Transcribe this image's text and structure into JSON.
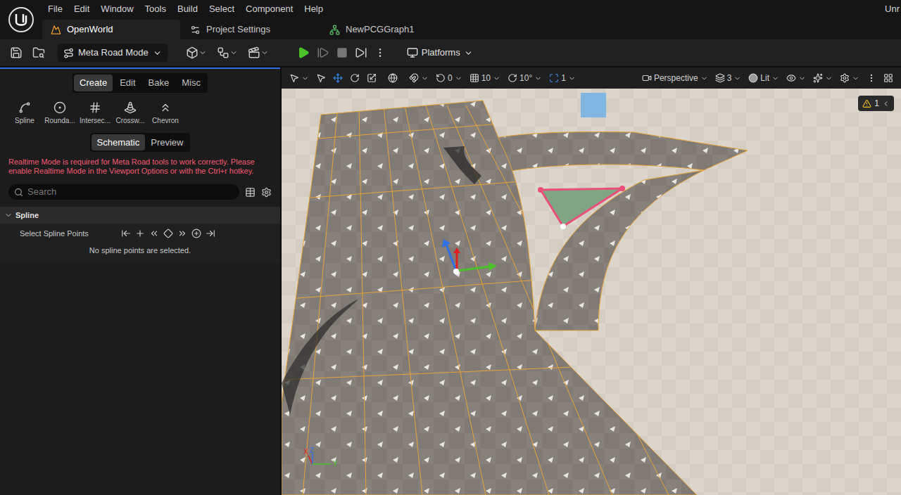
{
  "window": {
    "title": "Unr"
  },
  "menu": [
    "File",
    "Edit",
    "Window",
    "Tools",
    "Build",
    "Select",
    "Component",
    "Help"
  ],
  "document_tabs": [
    {
      "label": "OpenWorld",
      "selected": true
    },
    {
      "label": "Project Settings",
      "selected": false
    },
    {
      "label": "NewPCGGraph1",
      "selected": false
    }
  ],
  "toolbar": {
    "mode": "Meta Road Mode",
    "platforms": "Platforms"
  },
  "mode_tabs": [
    {
      "label": "Create",
      "selected": true
    },
    {
      "label": "Edit",
      "selected": false
    },
    {
      "label": "Bake",
      "selected": false
    },
    {
      "label": "Misc",
      "selected": false
    }
  ],
  "tools": [
    {
      "label": "Spline"
    },
    {
      "label": "Rounda..."
    },
    {
      "label": "Intersec..."
    },
    {
      "label": "Crossw..."
    },
    {
      "label": "Chevron"
    }
  ],
  "view_modes": [
    {
      "label": "Schematic",
      "selected": true
    },
    {
      "label": "Preview",
      "selected": false
    }
  ],
  "warning": "Realtime Mode is required for Meta Road tools to work correctly. Please enable Realtime Mode in the Viewport Options or with the Ctrl+r hotkey.",
  "search": {
    "placeholder": "Search"
  },
  "sections": [
    {
      "title": "Spline",
      "expanded": true,
      "rows": [
        {
          "label": "Select Spline Points"
        }
      ],
      "empty_text": "No spline points are selected."
    }
  ],
  "viewport_toolbar": {
    "surface_snap": "0",
    "grid_snap": "10",
    "rotation_snap": "10°",
    "scale_snap": "1",
    "camera": "Perspective",
    "layers": "3",
    "view_mode": "Lit"
  },
  "viewport": {
    "warnings": "1",
    "axis_labels": [
      "X",
      "Z",
      "Y"
    ]
  }
}
